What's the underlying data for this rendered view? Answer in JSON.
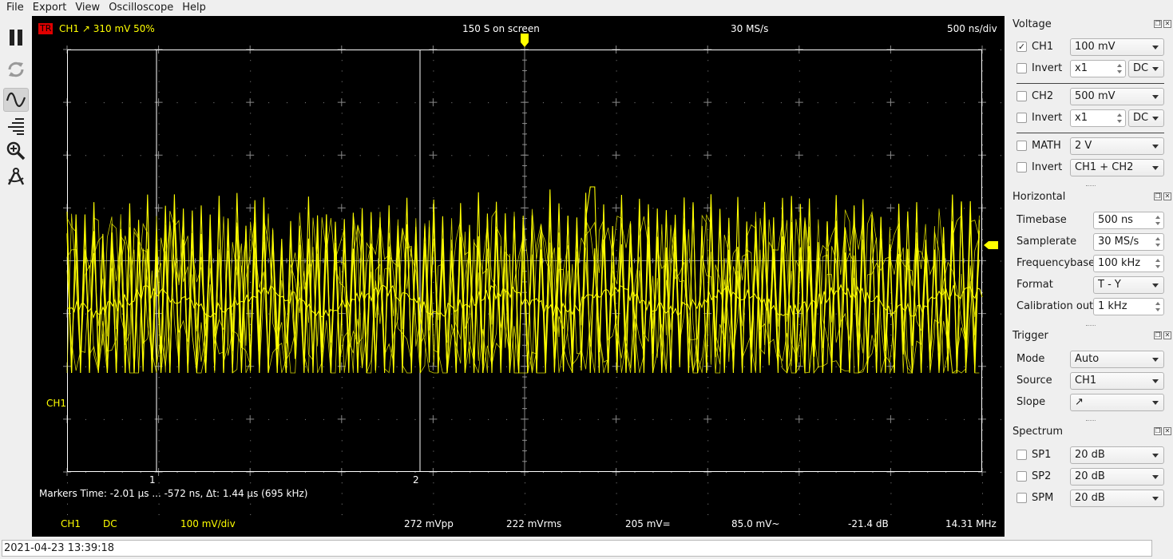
{
  "menu": [
    "File",
    "Export",
    "View",
    "Oscilloscope",
    "Help"
  ],
  "toolbar": [
    {
      "name": "pause-icon",
      "active": false
    },
    {
      "name": "refresh-icon",
      "active": false
    },
    {
      "name": "waveform-icon",
      "active": true
    },
    {
      "name": "spectrum-icon",
      "active": false
    },
    {
      "name": "zoom-icon",
      "active": false
    },
    {
      "name": "measure-icon",
      "active": false
    }
  ],
  "scope": {
    "trigger_badge": "TR",
    "trigger_info": "CH1  ↗  310 mV  50%",
    "samples_on_screen": "150 S on screen",
    "samplerate": "30 MS/s",
    "timebase": "500 ns/div",
    "channel_label": "CH1",
    "marker1": "1",
    "marker2": "2",
    "markers_info": "Markers  Time: -2.01 µs ... -572 ns,  Δt: 1.44 µs (695 kHz)",
    "meas": {
      "channel": "CH1",
      "coupling": "DC",
      "vdiv": "100 mV/div",
      "vpp": "272 mVpp",
      "vrms": "222 mVrms",
      "vdc": "205 mV=",
      "vac": "85.0 mV~",
      "db": "-21.4 dB",
      "freq": "14.31 MHz"
    },
    "trace_color": "#ffff00"
  },
  "voltage": {
    "title": "Voltage",
    "ch1": {
      "label": "CH1",
      "checked": "✓",
      "gain": "100 mV",
      "invert": "Invert",
      "probe": "x1",
      "coupling": "DC"
    },
    "ch2": {
      "label": "CH2",
      "checked": "",
      "gain": "500 mV",
      "invert": "Invert",
      "probe": "x1",
      "coupling": "DC"
    },
    "math": {
      "label": "MATH",
      "checked": "",
      "gain": "2 V",
      "invert": "Invert",
      "mode": "CH1 + CH2"
    }
  },
  "horizontal": {
    "title": "Horizontal",
    "timebase_label": "Timebase",
    "timebase": "500 ns",
    "samplerate_label": "Samplerate",
    "samplerate": "30 MS/s",
    "freqbase_label": "Frequencybase",
    "freqbase": "100 kHz",
    "format_label": "Format",
    "format": "T - Y",
    "calout_label": "Calibration out",
    "calout": "1 kHz"
  },
  "trigger": {
    "title": "Trigger",
    "mode_label": "Mode",
    "mode": "Auto",
    "source_label": "Source",
    "source": "CH1",
    "slope_label": "Slope",
    "slope": "↗"
  },
  "spectrum": {
    "title": "Spectrum",
    "sp1": {
      "label": "SP1",
      "checked": "",
      "value": "20 dB"
    },
    "sp2": {
      "label": "SP2",
      "checked": "",
      "value": "20 dB"
    },
    "spm": {
      "label": "SPM",
      "checked": "",
      "value": "20 dB"
    }
  },
  "status": "2021-04-23 13:39:18"
}
